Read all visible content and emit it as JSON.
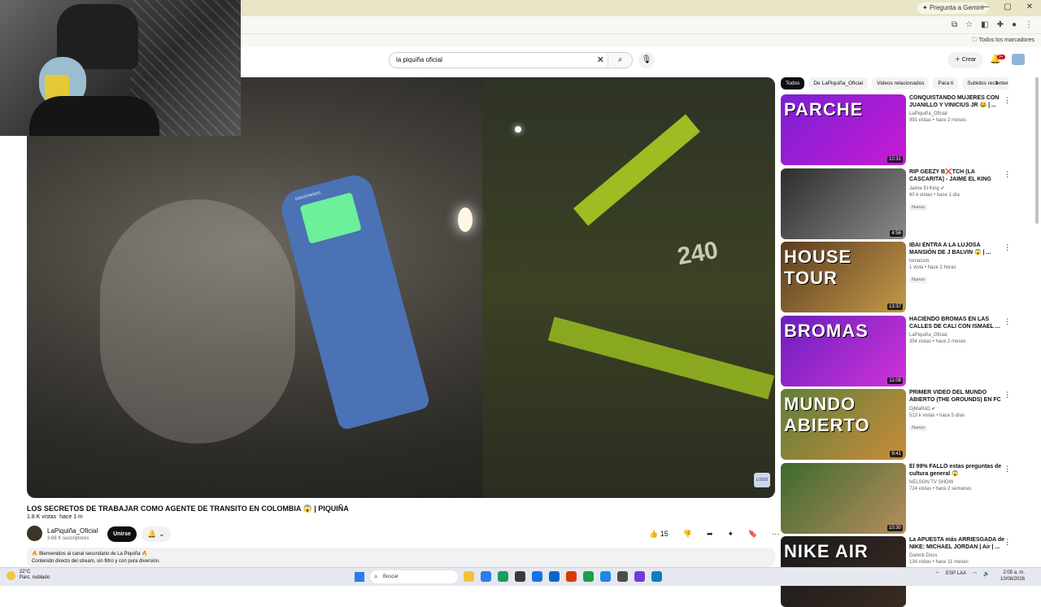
{
  "browser": {
    "gemini_label": "Pregunta a Gemini",
    "window_controls": [
      "—",
      "▢",
      "✕"
    ],
    "bookmarks_all": "Todos los marcadores"
  },
  "youtube": {
    "search_value": "la piquiña oficial",
    "create_label": "Crear",
    "notifications_count": "9+",
    "video": {
      "title": "LOS SECRETOS DE TRABAJAR COMO AGENTE DE TRANSITO EN COLOMBIA 😱 | PIQUIÑA",
      "views": "1.8 K vistas",
      "age": "hace 1 m",
      "channel": "LaPiquiña_Oficial",
      "subscribers": "3.68 K suscriptores",
      "join_label": "Unirse",
      "likes": "15",
      "vest_number": "240",
      "device_brand": "intoximeters",
      "description_line1": "🔥 Bienvenidos al canal secundario de La Piquiña 🔥",
      "description_line2": "Contenido directo del stream, sin filtro y con pura diversión."
    },
    "chips": [
      "Todos",
      "De LaPiquiña_Oficial",
      "Videos relacionados",
      "Para ti",
      "Subidos recientemente"
    ],
    "recommendations": [
      {
        "title": "CONQUISTANDO MUJERES CON JUANILLO Y VINICIUS JR 😂 | ...",
        "channel": "LaPiquiña_Oficial",
        "meta": "991 vistas • hace 2 meses",
        "badge": "",
        "duration": "10:31",
        "thumb_text": "PARCHE",
        "colors": [
          "#7a1fd6",
          "#c81bd1"
        ]
      },
      {
        "title": "RIP GEEZY B❌TCH (LA CASCARITA) - JAIME EL KING",
        "channel": "Jaime El King ✔",
        "meta": "60 k vistas • hace 1 día",
        "badge": "Nuevo",
        "duration": "4:56",
        "thumb_text": "",
        "colors": [
          "#2d2d2d",
          "#8a8a8a"
        ]
      },
      {
        "title": "IBAI ENTRA A LA LUJOSA MANSIÓN DE J BALVIN 😱 | ...",
        "channel": "tomacsm",
        "meta": "1 vista • hace 2 horas",
        "badge": "Nuevo",
        "duration": "13:37",
        "thumb_text": "HOUSE TOUR",
        "colors": [
          "#5a3b1f",
          "#c59a4a"
        ]
      },
      {
        "title": "HACIENDO BROMAS EN LAS CALLES DE CALI CON ISMAEL ...",
        "channel": "LaPiquiña_Oficial",
        "meta": "354 vistas • hace 2 meses",
        "badge": "",
        "duration": "11:08",
        "thumb_text": "BROMAS",
        "colors": [
          "#6a1fbe",
          "#d033d9"
        ]
      },
      {
        "title": "PRIMER VIDEO DEL MUNDO ABIERTO (THE GROUNDS) EN FC ...",
        "channel": "DjMaRiiO ✔",
        "meta": "513 k vistas • hace 5 días",
        "badge": "Nuevo",
        "duration": "9:41",
        "thumb_text": "MUNDO ABIERTO",
        "colors": [
          "#5f7f3a",
          "#c98b3a"
        ]
      },
      {
        "title": "El 99% FALLÓ estas preguntas de cultura general 😱",
        "channel": "NELSON TV SHOW",
        "meta": "724 vistas • hace 2 semanas",
        "badge": "",
        "duration": "10:30",
        "thumb_text": "",
        "colors": [
          "#3d6a2e",
          "#b88d5c"
        ]
      },
      {
        "title": "La APUESTA más ARRIESGADA de NIKE: MICHAEL JORDAN | Air | ...",
        "channel": "Dareck Docs",
        "meta": "134 vistas • hace 11 meses",
        "badge": "",
        "duration": "",
        "thumb_text": "NIKE AIR",
        "colors": [
          "#1a1a1a",
          "#3a2a22"
        ]
      }
    ]
  },
  "taskbar": {
    "weather_temp": "22°C",
    "weather_desc": "Parc. nublado",
    "search_label": "Buscar",
    "lang_line1": "ESP",
    "lang_line2": "LAA",
    "time": "2:05 a. m.",
    "date": "10/08/2026",
    "app_colors": [
      "#f0c23a",
      "#2b7de9",
      "#1c9c5e",
      "#3a3a3a",
      "#1473e6",
      "#0b66c3",
      "#d83b01",
      "#18a04a",
      "#1e88e5",
      "#4c4c4c",
      "#6e3bd8",
      "#0f7dbd"
    ]
  }
}
